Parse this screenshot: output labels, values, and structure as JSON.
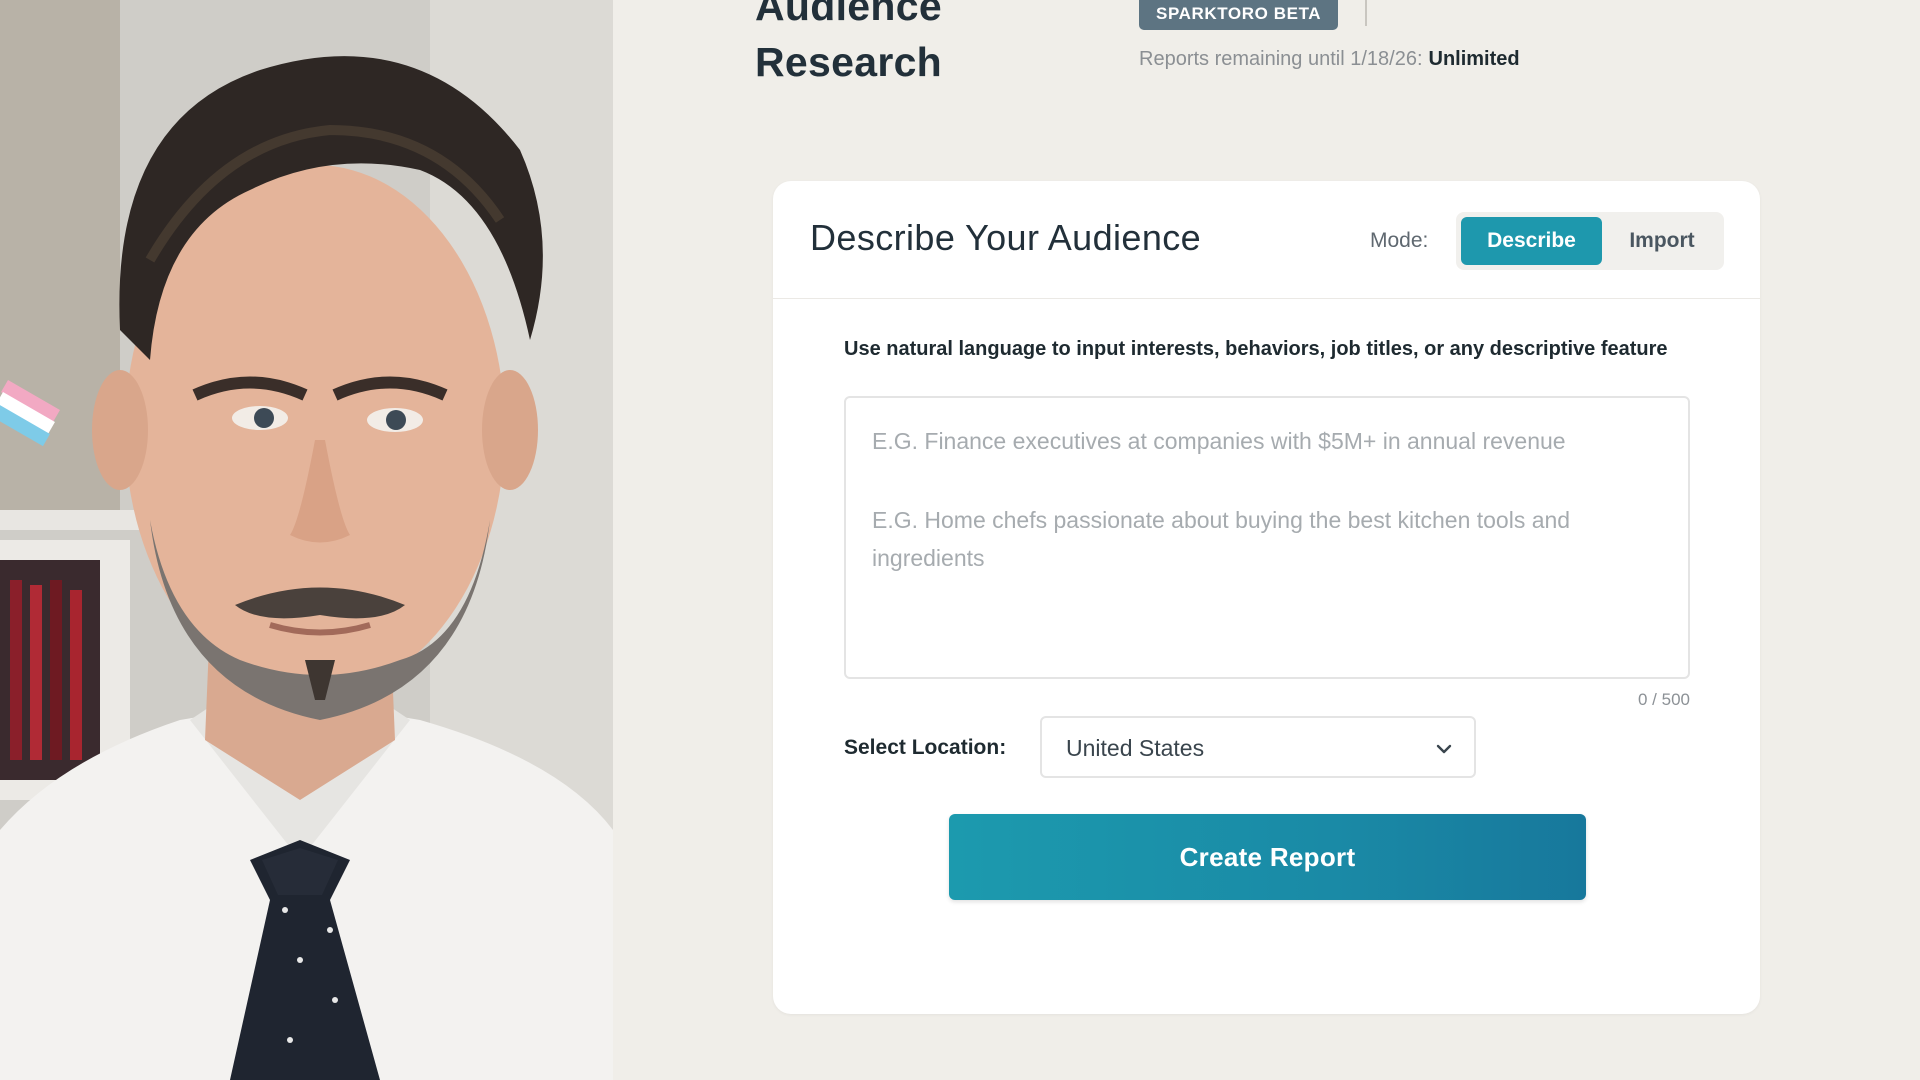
{
  "header": {
    "title_line1": "Audience",
    "title_line2": "Research",
    "badge": "SPARKTORO BETA",
    "reports_remaining_label": "Reports remaining until 1/18/26:",
    "reports_remaining_value": "Unlimited"
  },
  "card": {
    "title": "Describe Your Audience",
    "mode_label": "Mode:",
    "modes": [
      {
        "label": "Describe",
        "active": true
      },
      {
        "label": "Import",
        "active": false
      }
    ],
    "instructions": "Use natural language to input interests, behaviors, job titles, or any descriptive feature",
    "textarea": {
      "value": "",
      "placeholder_line1": "E.G. Finance executives at companies with $5M+ in annual revenue",
      "placeholder_line2": "E.G. Home chefs passionate about buying the best kitchen tools and ingredients"
    },
    "char_counter": "0 / 500",
    "location_label": "Select Location:",
    "location_selected": "United States",
    "submit_label": "Create Report"
  },
  "icons": {
    "location_dropdown": "chevron-down-icon"
  },
  "colors": {
    "accent": "#1e98ad",
    "button_gradient_end": "#17789c",
    "badge_bg": "#5d7482",
    "page_bg": "#f0eee9"
  }
}
